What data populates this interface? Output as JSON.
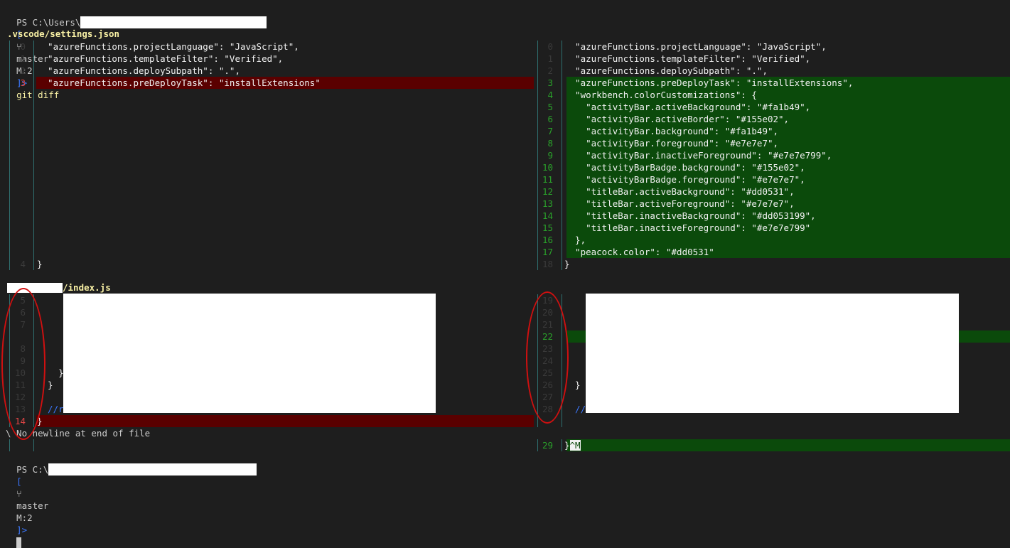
{
  "terminal": {
    "prompt_top": {
      "ps": "PS C:\\Users\\",
      "bracket_open": "[",
      "branch_icon": "⑂",
      "branch": "master",
      "status": "M:2",
      "bracket_close": "]>",
      "command": "git diff"
    },
    "prompt_bottom": {
      "ps": "PS C:\\",
      "bracket_open": "[",
      "branch_icon": "⑂",
      "branch": "master",
      "status": "M:2",
      "bracket_close": "]>"
    }
  },
  "file1": {
    "name": ".vscode/settings.json",
    "left": [
      {
        "n": "0",
        "t": "  \"azureFunctions.projectLanguage\": \"JavaScript\","
      },
      {
        "n": "1",
        "t": "  \"azureFunctions.templateFilter\": \"Verified\","
      },
      {
        "n": "2",
        "t": "  \"azureFunctions.deploySubpath\": \".\","
      },
      {
        "n": "3",
        "t": "  \"azureFunctions.preDeployTask\": \"installExtensions\""
      },
      {
        "n": "4",
        "t": "}"
      }
    ],
    "right": [
      {
        "n": "0",
        "t": "  \"azureFunctions.projectLanguage\": \"JavaScript\","
      },
      {
        "n": "1",
        "t": "  \"azureFunctions.templateFilter\": \"Verified\","
      },
      {
        "n": "2",
        "t": "  \"azureFunctions.deploySubpath\": \".\","
      },
      {
        "n": "3",
        "t": "  \"azureFunctions.preDeployTask\": \"installExtensions\","
      },
      {
        "n": "4",
        "t": "  \"workbench.colorCustomizations\": {"
      },
      {
        "n": "5",
        "t": "    \"activityBar.activeBackground\": \"#fa1b49\","
      },
      {
        "n": "6",
        "t": "    \"activityBar.activeBorder\": \"#155e02\","
      },
      {
        "n": "7",
        "t": "    \"activityBar.background\": \"#fa1b49\","
      },
      {
        "n": "8",
        "t": "    \"activityBar.foreground\": \"#e7e7e7\","
      },
      {
        "n": "9",
        "t": "    \"activityBar.inactiveForeground\": \"#e7e7e799\","
      },
      {
        "n": "10",
        "t": "    \"activityBarBadge.background\": \"#155e02\","
      },
      {
        "n": "11",
        "t": "    \"activityBarBadge.foreground\": \"#e7e7e7\","
      },
      {
        "n": "12",
        "t": "    \"titleBar.activeBackground\": \"#dd0531\","
      },
      {
        "n": "13",
        "t": "    \"titleBar.activeForeground\": \"#e7e7e7\","
      },
      {
        "n": "14",
        "t": "    \"titleBar.inactiveBackground\": \"#dd053199\","
      },
      {
        "n": "15",
        "t": "    \"titleBar.inactiveForeground\": \"#e7e7e799\""
      },
      {
        "n": "16",
        "t": "  },"
      },
      {
        "n": "17",
        "t": "  \"peacock.color\": \"#dd0531\""
      },
      {
        "n": "18",
        "t": "}"
      }
    ]
  },
  "file2": {
    "name": "/index.js",
    "left": [
      {
        "n": "5",
        "t": ""
      },
      {
        "n": "6",
        "t": ""
      },
      {
        "n": "7",
        "t": ""
      },
      {
        "n": "8",
        "t": ""
      },
      {
        "n": "9",
        "t": ""
      },
      {
        "n": "10",
        "t": "    }"
      },
      {
        "n": "11",
        "t": "  }"
      },
      {
        "n": "12",
        "t": ""
      },
      {
        "n": "13",
        "t": "  //r"
      },
      {
        "n": "14",
        "t": "}"
      }
    ],
    "no_newline": "\\ No newline at end of file",
    "right": [
      {
        "n": "19",
        "t": ""
      },
      {
        "n": "20",
        "t": ""
      },
      {
        "n": "21",
        "t": ""
      },
      {
        "n": "22",
        "t": ""
      },
      {
        "n": "23",
        "t": ""
      },
      {
        "n": "24",
        "t": ""
      },
      {
        "n": "25",
        "t": "    }"
      },
      {
        "n": "26",
        "t": "  }"
      },
      {
        "n": "27",
        "t": ""
      },
      {
        "n": "28",
        "t": "  //"
      },
      {
        "n": "29",
        "t": "}"
      }
    ],
    "right_last_suffix": "^M"
  },
  "colors": {
    "background": "#1e1e1e",
    "deleted_bg": "#5a0000",
    "added_bg": "#0b4a0b",
    "filename": "#f9f1a5",
    "annotation": "#d01010"
  }
}
